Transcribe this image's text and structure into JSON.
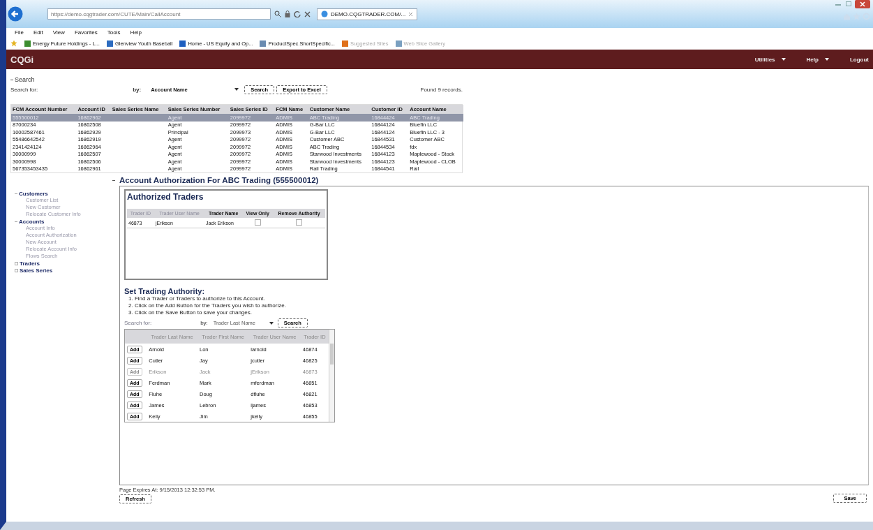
{
  "browser": {
    "address": "https://demo.cqgtrader.com/CUTE/Main/CallAccount",
    "tab": "DEMO.CQGTRADER.COM/...",
    "menu": [
      "File",
      "Edit",
      "View",
      "Favorites",
      "Tools",
      "Help"
    ],
    "favorites": [
      "Energy Future Holdings - L...",
      "Glenview Youth Baseball",
      "Home - US Equity and Op...",
      "ProductSpec.ShortSpecific...",
      "Suggested Sites",
      "Web Slice Gallery"
    ]
  },
  "app": {
    "logo": "CQGi",
    "nav": [
      {
        "label": "Utilities",
        "dropdown": true
      },
      {
        "label": "Help",
        "dropdown": true
      },
      {
        "label": "Logout",
        "dropdown": false
      }
    ]
  },
  "search": {
    "title": "Search",
    "search_for_label": "Search for:",
    "by_label": "by:",
    "by_value": "Account Name",
    "buttons": [
      "Search",
      "Export to Excel"
    ],
    "found": "Found 9 records."
  },
  "accounts_table": {
    "columns": [
      "FCM Account Number",
      "Account ID",
      "Sales Series Name",
      "Sales Series Number",
      "Sales Series ID",
      "FCM Name",
      "Customer Name",
      "Customer ID",
      "Account Name"
    ],
    "rows": [
      {
        "selected": true,
        "cells": [
          "555500012",
          "16862962",
          "",
          "Agent",
          "2099972",
          "ADMIS",
          "ABC Trading",
          "16844424",
          "ABC Trading"
        ]
      },
      {
        "selected": false,
        "cells": [
          "87000234",
          "16862508",
          "",
          "Agent",
          "2099972",
          "ADMIS",
          "G-Bar LLC",
          "16844124",
          "Bluefin LLC"
        ]
      },
      {
        "selected": false,
        "cells": [
          "10002587461",
          "16862929",
          "",
          "Principal",
          "2099973",
          "ADMIS",
          "G-Bar LLC",
          "16844124",
          "Bluefin LLC - 3"
        ]
      },
      {
        "selected": false,
        "cells": [
          "55486642542",
          "16862919",
          "",
          "Agent",
          "2099972",
          "ADMIS",
          "Customer ABC",
          "16844531",
          "Customer ABC"
        ]
      },
      {
        "selected": false,
        "cells": [
          "2341424124",
          "16862964",
          "",
          "Agent",
          "2099972",
          "ADMIS",
          "ABC Trading",
          "16844534",
          "fdx"
        ]
      },
      {
        "selected": false,
        "cells": [
          "30000999",
          "16862507",
          "",
          "Agent",
          "2099972",
          "ADMIS",
          "Starwood Investments",
          "16844123",
          "Maplewood - Stock"
        ]
      },
      {
        "selected": false,
        "cells": [
          "30000998",
          "16862506",
          "",
          "Agent",
          "2099972",
          "ADMIS",
          "Starwood Investments",
          "16844123",
          "Maplewood - CLOB"
        ]
      },
      {
        "selected": false,
        "cells": [
          "567353453435",
          "16862961",
          "",
          "Agent",
          "2099972",
          "ADMIS",
          "Rail Trading",
          "16844541",
          "Rail"
        ]
      }
    ]
  },
  "sidebar": [
    {
      "label": "Customers",
      "expanded": true,
      "children": [
        {
          "label": "Customer List"
        },
        {
          "label": "New Customer"
        },
        {
          "label": "Relocate Customer Info"
        }
      ]
    },
    {
      "label": "Accounts",
      "expanded": true,
      "children": [
        {
          "label": "Account Info"
        },
        {
          "label": "Account Authorization"
        },
        {
          "label": "New Account"
        },
        {
          "label": "Relocate Account Info"
        },
        {
          "label": "Flows Search"
        }
      ]
    },
    {
      "label": "Traders",
      "expanded": false
    },
    {
      "label": "Sales Series",
      "expanded": false
    }
  ],
  "main": {
    "title": "Account Authorization For ABC Trading (555500012)",
    "authorized": {
      "title": "Authorized Traders",
      "columns": [
        "Trader ID",
        "Trader User Name",
        "Trader Name",
        "View Only",
        "Remove Authority"
      ],
      "rows": [
        {
          "cells": [
            "46873",
            "jErikson",
            "Jack Erikson"
          ],
          "view_only": false,
          "remove": false
        }
      ]
    },
    "set_authority": {
      "title": "Set Trading Authority:",
      "steps": [
        "1. Find a Trader or Traders to authorize to this Account.",
        "2. Click on the Add Button for the Traders you wish to authorize.",
        "3. Click on the Save Button to save your changes."
      ],
      "search_for_label": "Search for:",
      "by_label": "by:",
      "by_value": "Trader Last Name",
      "search_button": "Search",
      "columns": [
        "Trader Last Name",
        "Trader First Name",
        "Trader User Name",
        "Trader ID"
      ],
      "rows": [
        {
          "button": "Add",
          "disabled": false,
          "cells": [
            "Arnold",
            "Lon",
            "larnold",
            "46874"
          ]
        },
        {
          "button": "Add",
          "disabled": false,
          "cells": [
            "Cutler",
            "Jay",
            "jcutler",
            "46825"
          ]
        },
        {
          "button": "Add",
          "disabled": true,
          "cells": [
            "Erikson",
            "Jack",
            "jErikson",
            "46873"
          ]
        },
        {
          "button": "Add",
          "disabled": false,
          "cells": [
            "Ferdman",
            "Mark",
            "mferdman",
            "46851"
          ]
        },
        {
          "button": "Add",
          "disabled": false,
          "cells": [
            "Fluhe",
            "Doug",
            "dfluhe",
            "46821"
          ]
        },
        {
          "button": "Add",
          "disabled": false,
          "cells": [
            "James",
            "Lebron",
            "ljames",
            "46853"
          ]
        },
        {
          "button": "Add",
          "disabled": false,
          "cells": [
            "Kelly",
            "Jim",
            "jkelly",
            "46855"
          ]
        }
      ]
    }
  },
  "footer": {
    "expires": "Page Expires At: 9/15/2013 12:32:53 PM.",
    "refresh": "Refresh",
    "save": "Save"
  }
}
